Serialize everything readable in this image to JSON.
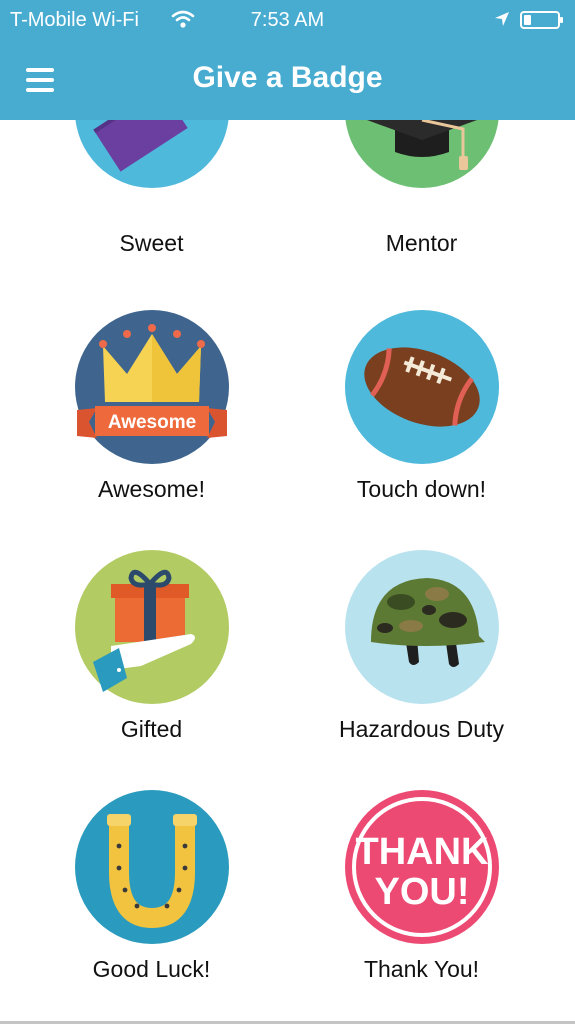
{
  "status_bar": {
    "carrier": "T-Mobile Wi-Fi",
    "time": "7:53 AM",
    "icons": [
      "wifi-icon",
      "location-arrow-icon",
      "battery-icon"
    ]
  },
  "nav": {
    "title": "Give a Badge",
    "menu_icon": "hamburger-menu-icon",
    "bar_color": "#48acd1"
  },
  "badges": [
    {
      "label": "Sweet",
      "icon": "chocolate-bar-icon",
      "bg_color": "#4fb9dc"
    },
    {
      "label": "Mentor",
      "icon": "graduation-cap-icon",
      "bg_color": "#6cbf73"
    },
    {
      "label": "Awesome!",
      "icon": "crown-icon",
      "ribbon_text": "Awesome",
      "bg_color": "#3f658e"
    },
    {
      "label": "Touch down!",
      "icon": "football-icon",
      "bg_color": "#4fb9dc"
    },
    {
      "label": "Gifted",
      "icon": "gift-hand-icon",
      "bg_color": "#b2cb63"
    },
    {
      "label": "Hazardous Duty",
      "icon": "army-helmet-icon",
      "bg_color": "#b9e2ef"
    },
    {
      "label": "Good Luck!",
      "icon": "horseshoe-icon",
      "bg_color": "#2a9bbe"
    },
    {
      "label": "Thank You!",
      "icon": "thank-you-stamp-icon",
      "stamp_text": [
        "THANK",
        "YOU!"
      ],
      "bg_color": "#ec4a73"
    }
  ]
}
